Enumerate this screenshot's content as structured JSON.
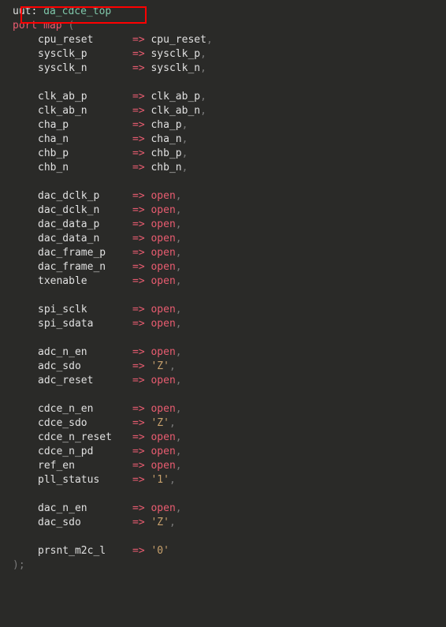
{
  "header": {
    "label": "uut",
    "type": "da_cdce_top"
  },
  "keywords": {
    "port": "port",
    "map": "map",
    "open": "open"
  },
  "punct": {
    "colon": ":",
    "lparen": "(",
    "rparen": ")",
    "arrow": "=>",
    "comma": ",",
    "semi": ";"
  },
  "groups": [
    {
      "items": [
        {
          "name": "cpu_reset",
          "target_type": "sig",
          "target": "cpu_reset",
          "trailing_comma": true
        },
        {
          "name": "sysclk_p",
          "target_type": "sig",
          "target": "sysclk_p",
          "trailing_comma": true
        },
        {
          "name": "sysclk_n",
          "target_type": "sig",
          "target": "sysclk_n",
          "trailing_comma": true
        }
      ]
    },
    {
      "items": [
        {
          "name": "clk_ab_p",
          "target_type": "sig",
          "target": "clk_ab_p",
          "trailing_comma": true
        },
        {
          "name": "clk_ab_n",
          "target_type": "sig",
          "target": "clk_ab_n",
          "trailing_comma": true
        },
        {
          "name": "cha_p",
          "target_type": "sig",
          "target": "cha_p",
          "trailing_comma": true
        },
        {
          "name": "cha_n",
          "target_type": "sig",
          "target": "cha_n",
          "trailing_comma": true
        },
        {
          "name": "chb_p",
          "target_type": "sig",
          "target": "chb_p",
          "trailing_comma": true
        },
        {
          "name": "chb_n",
          "target_type": "sig",
          "target": "chb_n",
          "trailing_comma": true
        }
      ]
    },
    {
      "items": [
        {
          "name": "dac_dclk_p",
          "target_type": "open",
          "target": "open",
          "trailing_comma": true
        },
        {
          "name": "dac_dclk_n",
          "target_type": "open",
          "target": "open",
          "trailing_comma": true
        },
        {
          "name": "dac_data_p",
          "target_type": "open",
          "target": "open",
          "trailing_comma": true
        },
        {
          "name": "dac_data_n",
          "target_type": "open",
          "target": "open",
          "trailing_comma": true
        },
        {
          "name": "dac_frame_p",
          "target_type": "open",
          "target": "open",
          "trailing_comma": true
        },
        {
          "name": "dac_frame_n",
          "target_type": "open",
          "target": "open",
          "trailing_comma": true
        },
        {
          "name": "txenable",
          "target_type": "open",
          "target": "open",
          "trailing_comma": true
        }
      ]
    },
    {
      "items": [
        {
          "name": "spi_sclk",
          "target_type": "open",
          "target": "open",
          "trailing_comma": true
        },
        {
          "name": "spi_sdata",
          "target_type": "open",
          "target": "open",
          "trailing_comma": true
        }
      ]
    },
    {
      "items": [
        {
          "name": "adc_n_en",
          "target_type": "open",
          "target": "open",
          "trailing_comma": true
        },
        {
          "name": "adc_sdo",
          "target_type": "char",
          "target": "'Z'",
          "trailing_comma": true
        },
        {
          "name": "adc_reset",
          "target_type": "open",
          "target": "open",
          "trailing_comma": true
        }
      ]
    },
    {
      "items": [
        {
          "name": "cdce_n_en",
          "target_type": "open",
          "target": "open",
          "trailing_comma": true
        },
        {
          "name": "cdce_sdo",
          "target_type": "char",
          "target": "'Z'",
          "trailing_comma": true
        },
        {
          "name": "cdce_n_reset",
          "target_type": "open",
          "target": "open",
          "trailing_comma": true
        },
        {
          "name": "cdce_n_pd",
          "target_type": "open",
          "target": "open",
          "trailing_comma": true
        },
        {
          "name": "ref_en",
          "target_type": "open",
          "target": "open",
          "trailing_comma": true
        },
        {
          "name": "pll_status",
          "target_type": "char",
          "target": "'1'",
          "trailing_comma": true
        }
      ]
    },
    {
      "items": [
        {
          "name": "dac_n_en",
          "target_type": "open",
          "target": "open",
          "trailing_comma": true
        },
        {
          "name": "dac_sdo",
          "target_type": "char",
          "target": "'Z'",
          "trailing_comma": true
        }
      ]
    },
    {
      "items": [
        {
          "name": "prsnt_m2c_l",
          "target_type": "char",
          "target": "'0'",
          "trailing_comma": false
        }
      ]
    }
  ]
}
